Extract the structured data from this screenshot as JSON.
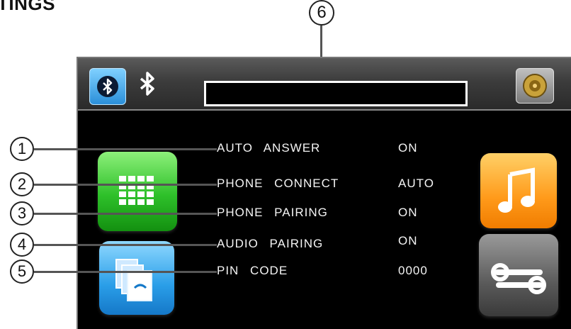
{
  "page_heading": "TINGS",
  "callouts": [
    "1",
    "2",
    "3",
    "4",
    "5",
    "6"
  ],
  "settings": [
    {
      "label": "AUTO ANSWER",
      "value": "ON"
    },
    {
      "label": "PHONE CONNECT",
      "value": "AUTO"
    },
    {
      "label": "PHONE PAIRING",
      "value": "ON"
    },
    {
      "label": "AUDIO PAIRING",
      "value": "ON"
    },
    {
      "label": "PIN CODE",
      "value": "0000"
    }
  ],
  "status_text": "",
  "icons": {
    "bluetooth_button": "bluetooth-icon",
    "bluetooth_status": "bluetooth-icon",
    "speaker": "speaker-icon",
    "keypad": "keypad-icon",
    "files": "files-icon",
    "music": "music-note-icon",
    "tools": "wrench-icon"
  },
  "colors": {
    "keypad": "#2ec02a",
    "files": "#2a9ee8",
    "music": "#ff9a1a",
    "tools": "#5a5a5a",
    "bluetooth": "#2b8fd9"
  }
}
